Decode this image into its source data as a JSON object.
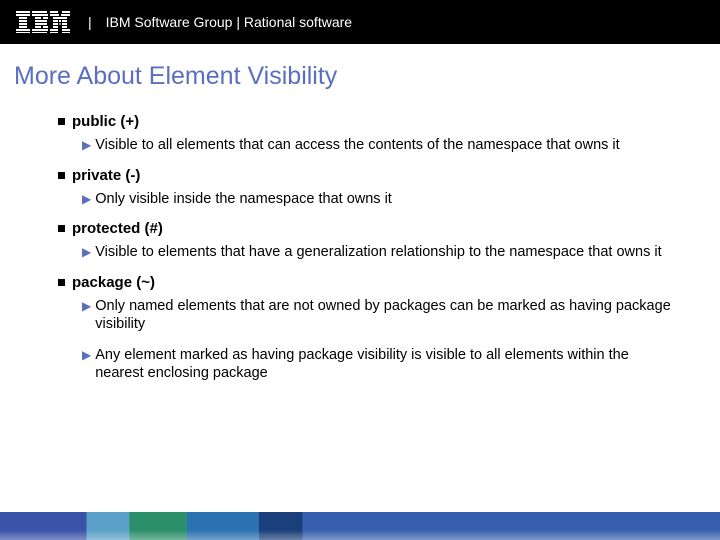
{
  "header": {
    "brand": "IBM",
    "text": "IBM Software Group | Rational software"
  },
  "title": "More About Element Visibility",
  "items": [
    {
      "label": "public (+)",
      "subs": [
        "Visible to all elements that can access the contents of the namespace that owns it"
      ]
    },
    {
      "label": "private (-)",
      "subs": [
        "Only visible inside the namespace that owns it"
      ]
    },
    {
      "label": "protected (#)",
      "subs": [
        "Visible to elements that have a generalization relationship to the namespace that owns it"
      ]
    },
    {
      "label": "package (~)",
      "subs": [
        "Only named elements that are not owned by packages can be marked as having package visibility",
        "Any element marked as having package visibility is visible to all elements within the nearest enclosing package"
      ]
    }
  ]
}
